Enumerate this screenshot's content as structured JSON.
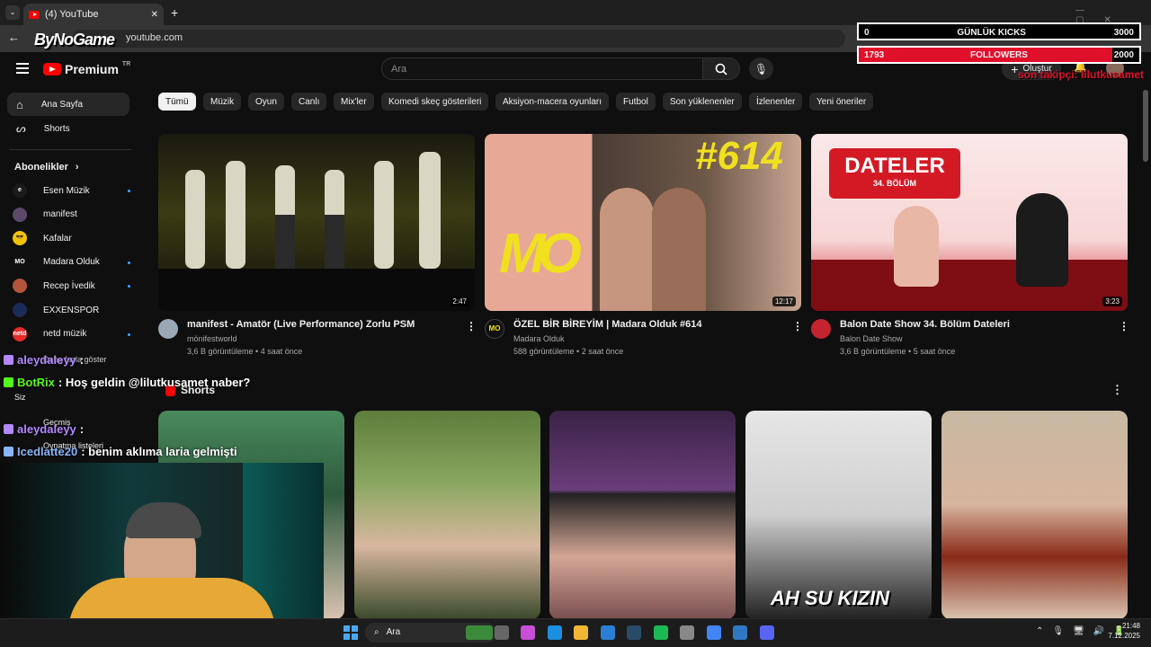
{
  "browser": {
    "tab_title": "(4) YouTube",
    "url": "youtube.com",
    "overlay_logo": "ByNoGame"
  },
  "header": {
    "brand": "Premium",
    "brand_sup": "TR",
    "search_placeholder": "Ara",
    "create_label": "Oluştur"
  },
  "stream_overlay": {
    "kicks_current": "0",
    "kicks_label": "GÜNLÜK KICKS",
    "kicks_goal": "3000",
    "followers_current": "1793",
    "followers_label": "FOLLOWERS",
    "followers_goal": "2000",
    "last_follower": "son takipçi: lilutkusamet"
  },
  "sidebar": {
    "home": "Ana Sayfa",
    "shorts": "Shorts",
    "subs_header": "Abonelikler",
    "subscriptions": [
      {
        "name": "Esen Müzik",
        "color": "#1a1a1a",
        "glyph": "e",
        "dot": true
      },
      {
        "name": "manifest",
        "color": "#5c4a68",
        "glyph": "",
        "dot": false
      },
      {
        "name": "Kafalar",
        "color": "#f2c400",
        "glyph": "😎",
        "dot": false
      },
      {
        "name": "Madara Olduk",
        "color": "#111111",
        "glyph": "MO",
        "dot": true
      },
      {
        "name": "Recep İvedik",
        "color": "#b2553a",
        "glyph": "",
        "dot": true
      },
      {
        "name": "EXXENSPOR",
        "color": "#1b2b57",
        "glyph": "",
        "dot": false
      },
      {
        "name": "netd müzik",
        "color": "#e52a2a",
        "glyph": "netd",
        "dot": true
      }
    ],
    "show_more": "Daha fazla göster",
    "you": "Siz",
    "history": "Geçmiş",
    "playlists": "Oynatma listeleri"
  },
  "chips": [
    "Tümü",
    "Müzik",
    "Oyun",
    "Canlı",
    "Mix'ler",
    "Komedi skeç gösterileri",
    "Aksiyon-macera oyunları",
    "Futbol",
    "Son yüklenenler",
    "İzlenenler",
    "Yeni öneriler"
  ],
  "videos": [
    {
      "title": "manifest - Amatör (Live Performance) Zorlu PSM",
      "channel": "mönifestworld",
      "meta": "3,6 B görüntüleme • 4 saat önce",
      "duration": "2:47",
      "avatar": "#9aa7b5"
    },
    {
      "title": "ÖZEL BİR BİREYİM | Madara Olduk #614",
      "channel": "Madara Olduk",
      "meta": "588 görüntüleme • 2 saat önce",
      "duration": "12:17",
      "avatar": "#111111",
      "overlay_text": "#614",
      "logo_text": "MO"
    },
    {
      "title": "Balon Date Show 34. Bölüm Dateleri",
      "channel": "Balon Date Show",
      "meta": "3,6 B görüntüleme • 5 saat önce",
      "duration": "3:23",
      "avatar": "#c4242e",
      "overlay_text": "DATELER",
      "overlay_sub": "34. BÖLÜM"
    }
  ],
  "shorts_section": {
    "label": "Shorts",
    "short_caption": "AH SU KIZIN"
  },
  "chat": [
    {
      "user": "aleydaleyy",
      "color": "#b388ff",
      "text": ":"
    },
    {
      "user": "BotRix",
      "color": "#53fc18",
      "text": ": Hoş geldin @lilutkusamet naber?"
    },
    {
      "user": "aleydaleyy",
      "color": "#b388ff",
      "text": ":"
    },
    {
      "user": "Icedlatte20",
      "color": "#8ab4f8",
      "text": ": benim aklıma laria gelmişti"
    }
  ],
  "taskbar": {
    "search": "Ara",
    "time": "21:48",
    "date": "7.12.2025"
  },
  "colors": {
    "brand_red": "#ff0000",
    "kick_green": "#53fc18",
    "followers_red": "#e0102a"
  }
}
